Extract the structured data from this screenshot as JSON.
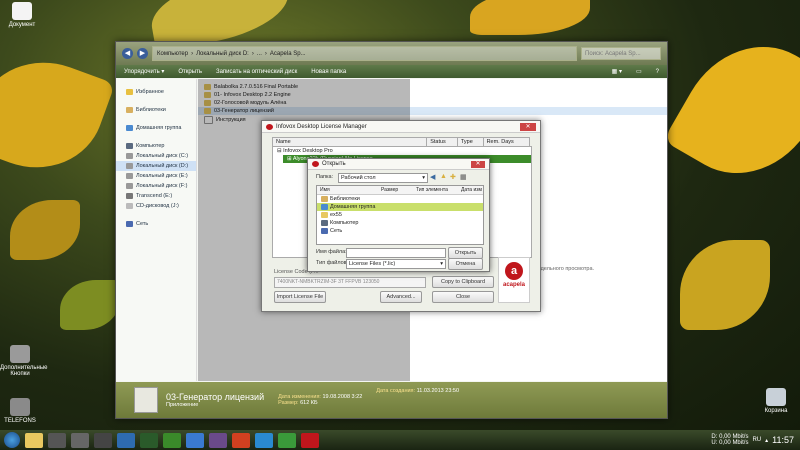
{
  "desktop": {
    "icons": [
      {
        "label": "Документ"
      },
      {
        "label": "Дополнительные Кнопки"
      },
      {
        "label": "TELEFONS"
      },
      {
        "label": "Корзина"
      }
    ]
  },
  "explorer": {
    "address": [
      "Компьютер",
      "Локальный диск D:",
      "...",
      "Acapela Sp..."
    ],
    "search_placeholder": "Поиск: Acapela Sp...",
    "commands": [
      "Упорядочить ▾",
      "Открыть",
      "Записать на оптический диск",
      "Новая папка"
    ],
    "nav": [
      {
        "label": "Избранное",
        "icon": "star-icon"
      },
      {
        "label": "Библиотеки",
        "icon": "library-icon"
      },
      {
        "label": "Домашняя группа",
        "icon": "homegroup-icon"
      },
      {
        "label": "Компьютер",
        "icon": "computer-icon"
      },
      {
        "label": "Локальный диск (C:)",
        "icon": "drive-icon"
      },
      {
        "label": "Локальный диск (D:)",
        "icon": "drive-icon",
        "selected": true
      },
      {
        "label": "Локальный диск (E:)",
        "icon": "drive-icon"
      },
      {
        "label": "Локальный диск (F:)",
        "icon": "drive-icon"
      },
      {
        "label": "Transcend (E:)",
        "icon": "usb-drive-icon"
      },
      {
        "label": "CD-дисковод (J:)",
        "icon": "cd-drive-icon"
      },
      {
        "label": "Сеть",
        "icon": "network-icon"
      }
    ],
    "files": [
      {
        "label": "Balabolka 2.7.0.516 Final Portable",
        "icon": "folder-icon"
      },
      {
        "label": "01- Infovox Desktop 2.2 Engine",
        "icon": "folder-icon"
      },
      {
        "label": "02-Голосовой модуль Алёна",
        "icon": "folder-icon"
      },
      {
        "label": "03-Генератор лицензий",
        "icon": "folder-icon",
        "selected": true
      },
      {
        "label": "Инструкция",
        "icon": "text-file-icon"
      }
    ],
    "side_note": "...дельного просмотра.",
    "details": {
      "name": "03-Генератор лицензий",
      "type": "Приложение",
      "modified_label": "Дата изменения:",
      "modified_value": "19.08.2008 3:22",
      "created_label": "Дата создания:",
      "created_value": "11.03.2013 23:50",
      "size_label": "Размер:",
      "size_value": "612 КБ"
    }
  },
  "license_manager": {
    "title": "Infovox Desktop License Manager",
    "columns": [
      "Name",
      "Status",
      "Type",
      "Rem. Days"
    ],
    "tree": [
      {
        "label": "Infovox Desktop Pro"
      },
      {
        "label": "Alyona22k (Russian)   No License..."
      }
    ],
    "license_code_label": "License Code (P...",
    "license_code_value": "7400NKT-NMBKTRZIM-3F 3T FFPVB 123050",
    "buttons": {
      "copy": "Copy to Clipboard",
      "import": "Import License File",
      "advanced": "Advanced...",
      "close": "Close"
    },
    "brand": "acapela"
  },
  "open_dialog": {
    "title": "Открыть",
    "folder_label": "Папка:",
    "folder_value": "Рабочий стол",
    "headers": [
      "Имя",
      "Размер",
      "Тип элемента",
      "Дата изм"
    ],
    "items": [
      {
        "label": "Библиотеки",
        "icon": "library-icon"
      },
      {
        "label": "Домашняя группа",
        "icon": "homegroup-icon",
        "selected": true
      },
      {
        "label": "ex55",
        "icon": "user-folder-icon"
      },
      {
        "label": "Компьютер",
        "icon": "computer-icon"
      },
      {
        "label": "Сеть",
        "icon": "network-icon"
      }
    ],
    "filename_label": "Имя файла:",
    "filetype_label": "Тип файлов:",
    "filetype_value": "License Files (*.lic)",
    "open_button": "Открыть",
    "cancel_button": "Отмена"
  },
  "taskbar": {
    "lang": "RU",
    "net_up": "0,00 Mbit/s",
    "net_down": "0,00 Mbit/s",
    "drive_d": "D:",
    "drive_u": "U:",
    "time": "11:57"
  }
}
